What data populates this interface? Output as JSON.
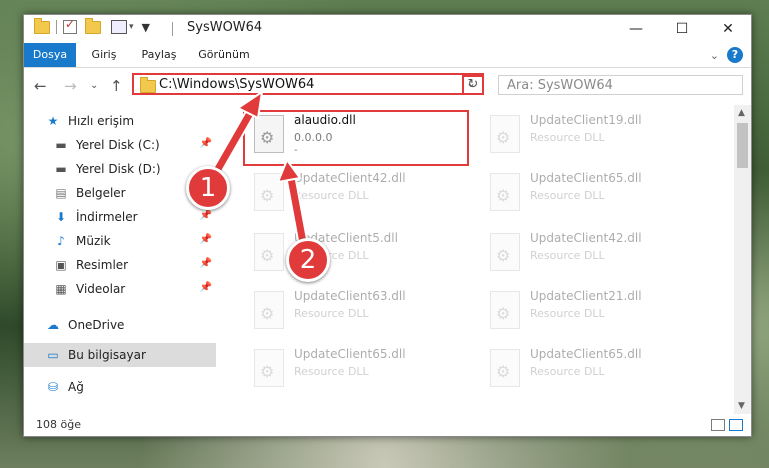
{
  "window": {
    "title": "SysWOW64",
    "minimize_icon": "minimize-icon",
    "maximize_icon": "maximize-icon",
    "close_icon": "close-icon"
  },
  "ribbon": {
    "tabs": [
      {
        "label": "Dosya"
      },
      {
        "label": "Giriş"
      },
      {
        "label": "Paylaş"
      },
      {
        "label": "Görünüm"
      }
    ]
  },
  "nav": {
    "address": "C:\\Windows\\SysWOW64",
    "search_placeholder": "Ara: SysWOW64"
  },
  "sidebar": {
    "items": [
      {
        "label": "Hızlı erişim"
      },
      {
        "label": "Yerel Disk (C:)"
      },
      {
        "label": "Yerel Disk (D:)"
      },
      {
        "label": "Belgeler"
      },
      {
        "label": "İndirmeler"
      },
      {
        "label": "Müzik"
      },
      {
        "label": "Resimler"
      },
      {
        "label": "Videolar"
      },
      {
        "label": "OneDrive"
      },
      {
        "label": "Bu bilgisayar"
      },
      {
        "label": "Ağ"
      }
    ]
  },
  "files": [
    {
      "name": "alaudio.dll",
      "sub1": "0.0.0.0",
      "sub2": "-"
    },
    {
      "name": "UpdateClient19.dll",
      "sub1": "Resource DLL"
    },
    {
      "name": "UpdateClient42.dll",
      "sub1": "Resource DLL"
    },
    {
      "name": "UpdateClient65.dll",
      "sub1": "Resource DLL"
    },
    {
      "name": "UpdateClient5.dll",
      "sub1": "Resource DLL"
    },
    {
      "name": "UpdateClient42.dll",
      "sub1": "Resource DLL"
    },
    {
      "name": "UpdateClient63.dll",
      "sub1": "Resource DLL"
    },
    {
      "name": "UpdateClient21.dll",
      "sub1": "Resource DLL"
    },
    {
      "name": "UpdateClient65.dll",
      "sub1": "Resource DLL"
    },
    {
      "name": "UpdateClient65.dll",
      "sub1": "Resource DLL"
    }
  ],
  "status": {
    "item_count": "108 öğe"
  },
  "annotations": {
    "step1": "1",
    "step2": "2"
  }
}
